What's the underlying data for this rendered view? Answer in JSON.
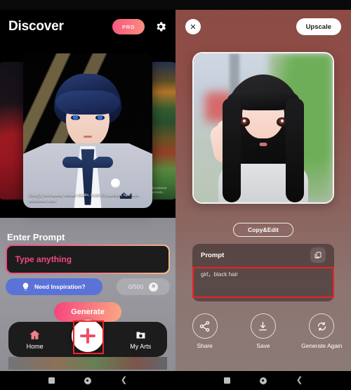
{
  "left": {
    "header": {
      "title": "Discover",
      "pro_label": "PRO",
      "settings_icon": "gear-icon"
    },
    "carousel": {
      "main_caption": "(((boy))), best quality, intricate details, (nude:0.5),spotlight, light rays, photoshoot, ultra",
      "right_caption": "A handsome\ngroomsm..."
    },
    "prompt": {
      "section_label": "Enter Prompt",
      "placeholder": "Type anything",
      "value": "",
      "inspiration_label": "Need Inspiration?",
      "inspiration_icon": "lightbulb-icon",
      "counter": "0/500",
      "clear_icon": "close-icon"
    },
    "generate_label": "Generate",
    "tabbar": {
      "items": [
        {
          "label": "Home",
          "icon": "home-icon"
        },
        {
          "label": "",
          "icon": "plus-icon"
        },
        {
          "label": "My Arts",
          "icon": "folder-photo-icon"
        }
      ]
    }
  },
  "right": {
    "header": {
      "close_icon": "close-icon",
      "upscale_label": "Upscale"
    },
    "copy_edit_label": "Copy&Edit",
    "prompt_card": {
      "title": "Prompt",
      "copy_icon": "copy-icon",
      "text": "girl，black hair"
    },
    "actions": [
      {
        "label": "Share",
        "icon": "share-icon"
      },
      {
        "label": "Save",
        "icon": "download-icon"
      },
      {
        "label": "Generate\nAgain",
        "icon": "refresh-icon"
      }
    ]
  },
  "highlights": {
    "fab_box_color": "#ef2027",
    "prompt_box_color": "#ef2027"
  },
  "colors": {
    "accent_pink": "#f6437f",
    "accent_orange": "#fba883",
    "inspiration_blue": "#5b72d8",
    "right_bg": "#8d4a44"
  },
  "navbar": {
    "recents_icon": "square-icon",
    "home_icon": "circle-icon",
    "back_icon": "chevron-left-icon"
  }
}
